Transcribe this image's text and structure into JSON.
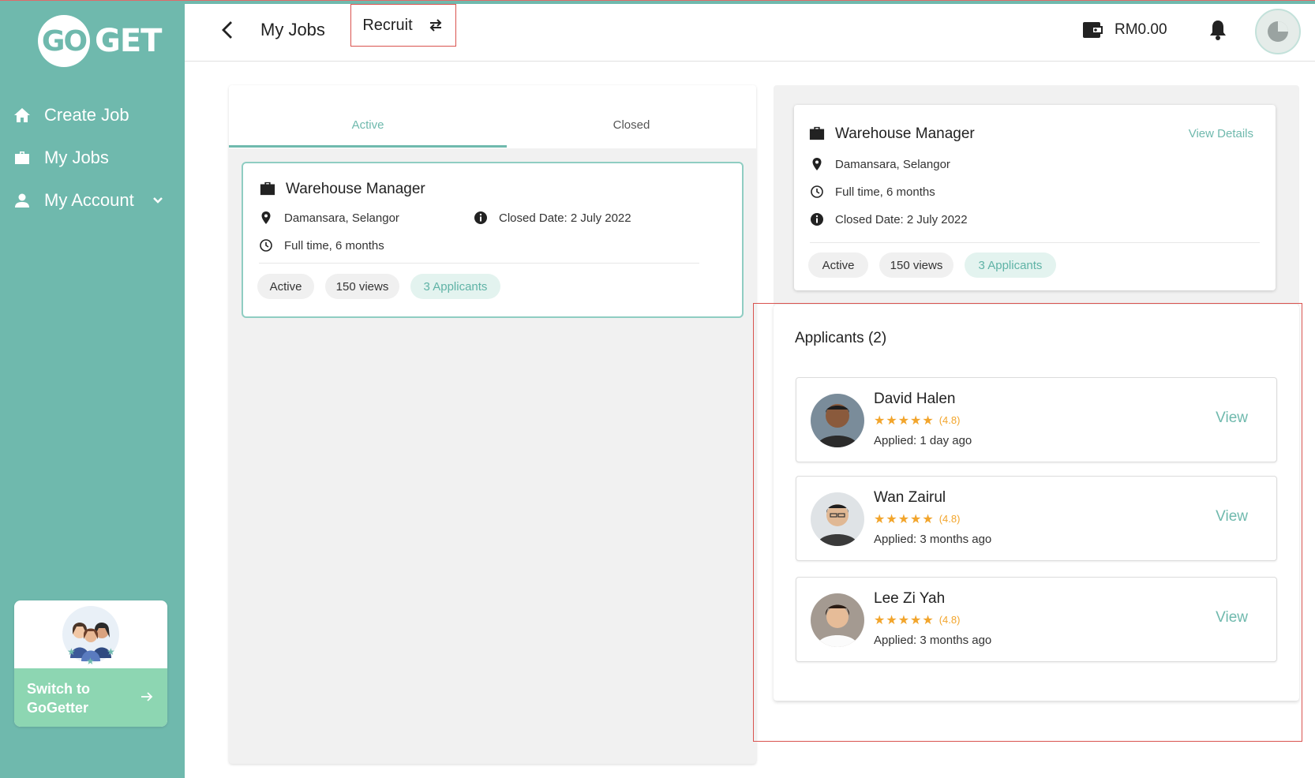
{
  "app": {
    "logo_go": "GO",
    "logo_get": "GET"
  },
  "sidebar": {
    "items": [
      {
        "label": "Create Job",
        "icon": "home-icon"
      },
      {
        "label": "My Jobs",
        "icon": "briefcase-icon"
      },
      {
        "label": "My Account",
        "icon": "user-icon"
      }
    ],
    "switch_label_line1": "Switch to",
    "switch_label_line2": "GoGetter"
  },
  "header": {
    "title": "My Jobs",
    "mode_label": "Recruit",
    "balance": "RM0.00"
  },
  "tabs": [
    {
      "label": "Active",
      "active": true
    },
    {
      "label": "Closed",
      "active": false
    }
  ],
  "job": {
    "title": "Warehouse Manager",
    "location": "Damansara, Selangor",
    "type": "Full time, 6 months",
    "closed_date_label": "Closed Date:",
    "closed_date": "2 July 2022",
    "status": "Active",
    "views": "150 views",
    "applicants": "3 Applicants"
  },
  "detail": {
    "view_details": "View Details"
  },
  "applicants": {
    "heading": "Applicants (2)",
    "list": [
      {
        "name": "David Halen",
        "rating": "(4.8)",
        "applied": "Applied: 1 day ago",
        "view": "View"
      },
      {
        "name": "Wan Zairul",
        "rating": "(4.8)",
        "applied": "Applied: 3 months ago",
        "view": "View"
      },
      {
        "name": "Lee Zi Yah",
        "rating": "(4.8)",
        "applied": "Applied: 3 months ago",
        "view": "View"
      }
    ]
  },
  "colors": {
    "brand": "#6fb9ad",
    "star": "#f2a52c",
    "highlight": "#d9534f"
  }
}
